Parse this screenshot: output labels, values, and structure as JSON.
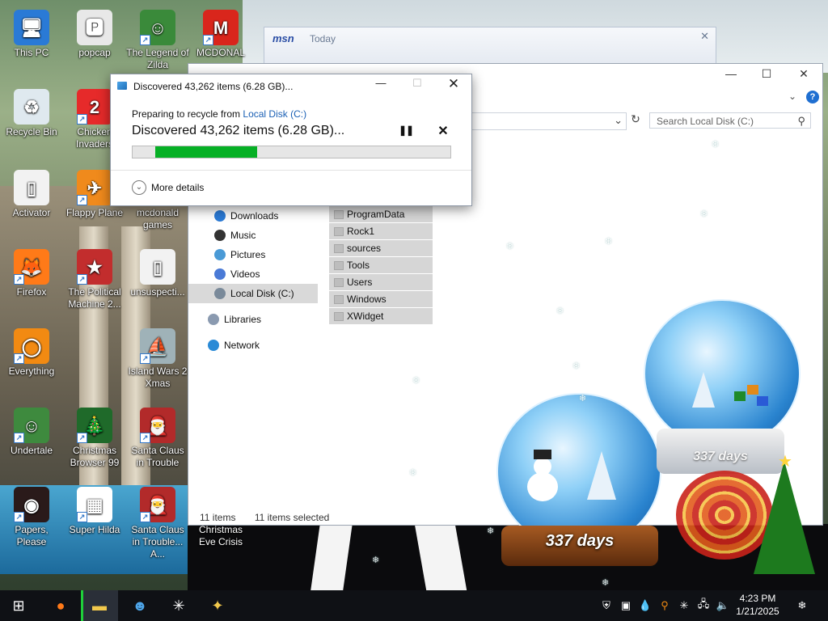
{
  "desktop": {
    "icons": [
      {
        "label": "This PC",
        "glyph": "🖥",
        "color": "#2a7ad6",
        "shortcut": false
      },
      {
        "label": "popcap",
        "glyph": "🅿",
        "color": "#e8e8e8",
        "shortcut": false
      },
      {
        "label": "The Legend of Zilda",
        "glyph": "☺",
        "color": "#3a8a3a",
        "shortcut": true
      },
      {
        "label": "MCDONAL",
        "glyph": "M",
        "color": "#d9261c",
        "shortcut": true
      },
      {
        "label": "Recycle Bin",
        "glyph": "♻",
        "color": "#dfe9ef",
        "shortcut": false
      },
      {
        "label": "Chicken Invaders",
        "glyph": "2",
        "color": "#e62a2a",
        "shortcut": true
      },
      {
        "label": "Activator",
        "glyph": "▯",
        "color": "#f2f2f2",
        "shortcut": false
      },
      {
        "label": "Flappy Plane",
        "glyph": "✈",
        "color": "#f08a1c",
        "shortcut": true
      },
      {
        "label": "mcdonald games",
        "glyph": "",
        "color": "transparent",
        "shortcut": false
      },
      {
        "label": "Firefox",
        "glyph": "🦊",
        "color": "#ff7a18",
        "shortcut": true
      },
      {
        "label": "The Political Machine 2...",
        "glyph": "★",
        "color": "#c22d2d",
        "shortcut": true
      },
      {
        "label": "unsuspecti...",
        "glyph": "▯",
        "color": "#f2f2f2",
        "shortcut": false
      },
      {
        "label": "Everything",
        "glyph": "◯",
        "color": "#f28a12",
        "shortcut": true
      },
      {
        "label": "Island Wars 2 Xmas",
        "glyph": "⛵",
        "color": "#9fb2b8",
        "shortcut": true
      },
      {
        "label": "Undertale",
        "glyph": "☺",
        "color": "#3e8a3e",
        "shortcut": true
      },
      {
        "label": "Christmas Browser 99",
        "glyph": "🎄",
        "color": "#1f6a2a",
        "shortcut": true
      },
      {
        "label": "Santa Claus in Trouble",
        "glyph": "🎅",
        "color": "#b22a2a",
        "shortcut": true
      },
      {
        "label": "Papers, Please",
        "glyph": "◉",
        "color": "#2a1a1a",
        "shortcut": true
      },
      {
        "label": "Super Hilda",
        "glyph": "▦",
        "color": "#ffffff",
        "shortcut": true
      },
      {
        "label": "Santa Claus in Trouble... A...",
        "glyph": "🎅",
        "color": "#b22a2a",
        "shortcut": true
      },
      {
        "label": "Christmas Eve Crisis",
        "glyph": "",
        "color": "transparent",
        "shortcut": false
      }
    ]
  },
  "msn": {
    "logo": "msn",
    "title": "Today"
  },
  "explorer": {
    "search_placeholder": "Search Local Disk (C:)",
    "nav": [
      {
        "label": "Downloads",
        "color": "#2a7ad6"
      },
      {
        "label": "Music",
        "color": "#333"
      },
      {
        "label": "Pictures",
        "color": "#4a9ad6"
      },
      {
        "label": "Videos",
        "color": "#4a7ad6"
      },
      {
        "label": "Local Disk (C:)",
        "color": "#7a8a9a"
      }
    ],
    "nav_top": [
      {
        "label": "Libraries",
        "color": "#8a9ab0"
      },
      {
        "label": "Network",
        "color": "#2a8ad6"
      }
    ],
    "files": [
      "ProgramData",
      "Rock1",
      "sources",
      "Tools",
      "Users",
      "Windows",
      "XWidget"
    ],
    "status_count": "11 items",
    "status_selected": "11 items selected"
  },
  "dialog": {
    "title": "Discovered 43,262 items (6.28 GB)...",
    "line1_prefix": "Preparing to recycle from",
    "line1_link": "Local Disk (C:)",
    "line2": "Discovered 43,262 items (6.28 GB)...",
    "progress": 0.32,
    "more_details": "More details"
  },
  "globes": {
    "left_label": "337 days",
    "right_label": "337 days"
  },
  "taskbar": {
    "time": "4:23 PM",
    "date": "1/21/2025"
  }
}
